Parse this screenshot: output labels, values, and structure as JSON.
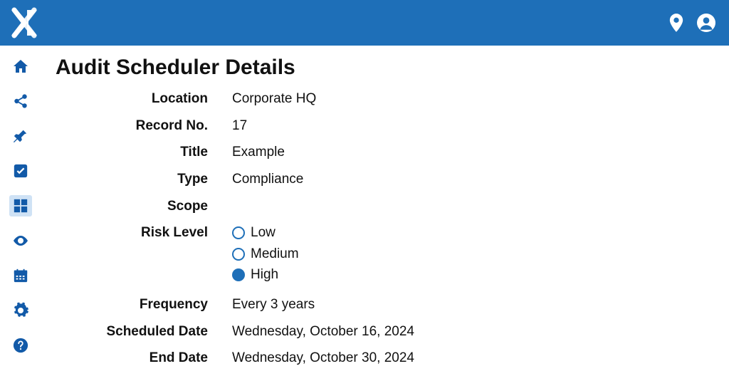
{
  "page_title": "Audit Scheduler Details",
  "fields": {
    "location": {
      "label": "Location",
      "value": "Corporate HQ"
    },
    "record_no": {
      "label": "Record No.",
      "value": "17"
    },
    "title": {
      "label": "Title",
      "value": "Example"
    },
    "type": {
      "label": "Type",
      "value": "Compliance"
    },
    "scope": {
      "label": "Scope",
      "value": ""
    },
    "risk_level": {
      "label": "Risk Level",
      "options": [
        "Low",
        "Medium",
        "High"
      ],
      "selected": "High"
    },
    "frequency": {
      "label": "Frequency",
      "value": "Every 3 years"
    },
    "scheduled_date": {
      "label": "Scheduled Date",
      "value": "Wednesday, October 16, 2024"
    },
    "end_date": {
      "label": "End Date",
      "value": "Wednesday, October 30, 2024"
    }
  }
}
